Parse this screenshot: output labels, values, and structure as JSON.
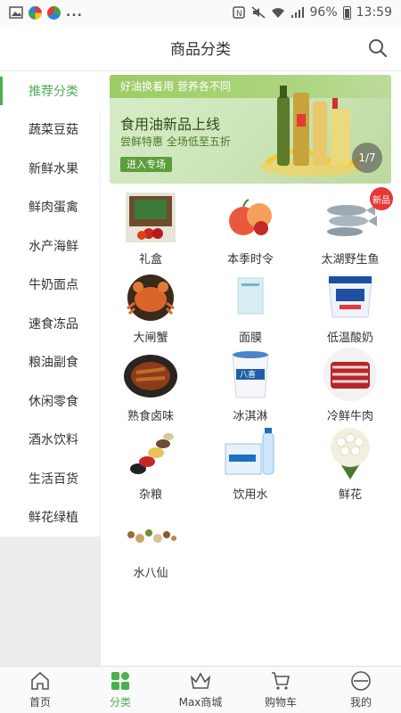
{
  "status": {
    "battery": "96%",
    "time": "13:59",
    "dots": "..."
  },
  "header": {
    "title": "商品分类"
  },
  "sidebar": {
    "items": [
      {
        "label": "推荐分类"
      },
      {
        "label": "蔬菜豆菇"
      },
      {
        "label": "新鲜水果"
      },
      {
        "label": "鲜肉蛋禽"
      },
      {
        "label": "水产海鲜"
      },
      {
        "label": "牛奶面点"
      },
      {
        "label": "速食冻品"
      },
      {
        "label": "粮油副食"
      },
      {
        "label": "休闲零食"
      },
      {
        "label": "酒水饮料"
      },
      {
        "label": "生活百货"
      },
      {
        "label": "鲜花绿植"
      }
    ],
    "active_index": 0
  },
  "banner": {
    "line1": "好油换着用 营养各不同",
    "line2": "食用油新品上线",
    "line3": "尝鲜特惠 全场低至五折",
    "button": "进入专场",
    "pager": "1/7"
  },
  "categories": [
    {
      "label": "礼盒",
      "icon": "gift-box-icon"
    },
    {
      "label": "本季时令",
      "icon": "seasonal-fruit-icon"
    },
    {
      "label": "太湖野生鱼",
      "icon": "fish-icon",
      "badge": "新品"
    },
    {
      "label": "大闸蟹",
      "icon": "crab-icon"
    },
    {
      "label": "面膜",
      "icon": "face-mask-icon"
    },
    {
      "label": "低温酸奶",
      "icon": "yogurt-icon"
    },
    {
      "label": "熟食卤味",
      "icon": "braised-meat-icon"
    },
    {
      "label": "冰淇淋",
      "icon": "ice-cream-icon"
    },
    {
      "label": "冷鲜牛肉",
      "icon": "beef-icon"
    },
    {
      "label": "杂粮",
      "icon": "grains-icon"
    },
    {
      "label": "饮用水",
      "icon": "water-icon"
    },
    {
      "label": "鲜花",
      "icon": "flower-icon"
    },
    {
      "label": "水八仙",
      "icon": "aquatic-vegetables-icon"
    }
  ],
  "tabbar": {
    "items": [
      {
        "label": "首页",
        "icon": "home-icon"
      },
      {
        "label": "分类",
        "icon": "category-icon"
      },
      {
        "label": "Max商城",
        "icon": "crown-icon"
      },
      {
        "label": "购物车",
        "icon": "cart-icon"
      },
      {
        "label": "我的",
        "icon": "profile-icon"
      }
    ],
    "active_index": 1
  },
  "colors": {
    "accent": "#4caf50",
    "badge": "#e53935"
  }
}
